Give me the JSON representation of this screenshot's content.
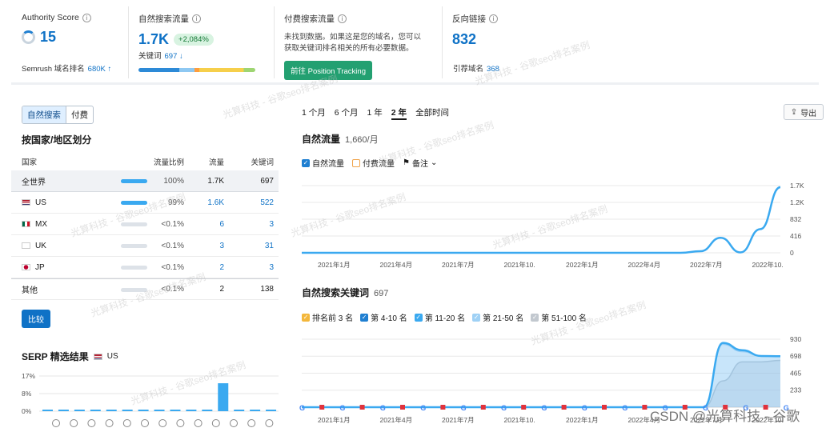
{
  "metrics": {
    "authority": {
      "label": "Authority Score",
      "value": "15",
      "sub_label": "Semrush 域名排名",
      "sub_value": "680K ↑"
    },
    "organic": {
      "label": "自然搜索流量",
      "value": "1.7K",
      "change": "+2,084%",
      "kw_label": "关键词",
      "kw_value": "697 ↓"
    },
    "paid": {
      "label": "付费搜索流量",
      "text": "未找到数据。如果这是您的域名，您可以获取关键词排名相关的所有必要数据。",
      "button": "前往 Position Tracking"
    },
    "backlinks": {
      "label": "反向链接",
      "value": "832",
      "sub_label": "引荐域名",
      "sub_value": "368"
    }
  },
  "left": {
    "toggle": [
      "自然搜索",
      "付费"
    ],
    "geo_title": "按国家/地区划分",
    "geo_columns": [
      "国家",
      "流量比例",
      "流量",
      "关键词"
    ],
    "geo_rows": [
      {
        "name": "全世界",
        "share": "100%",
        "traffic": "1.7K",
        "keywords": "697",
        "bar": 1.0
      },
      {
        "name": "US",
        "share": "99%",
        "traffic": "1.6K",
        "keywords": "522",
        "bar": 0.99
      },
      {
        "name": "MX",
        "share": "<0.1%",
        "traffic": "6",
        "keywords": "3",
        "bar": 0.0
      },
      {
        "name": "UK",
        "share": "<0.1%",
        "traffic": "3",
        "keywords": "31",
        "bar": 0.0
      },
      {
        "name": "JP",
        "share": "<0.1%",
        "traffic": "2",
        "keywords": "3",
        "bar": 0.0
      },
      {
        "name": "其他",
        "share": "<0.1%",
        "traffic": "2",
        "keywords": "138",
        "bar": 0.0
      }
    ],
    "compare_button": "比较",
    "serp_title": "SERP 精选结果",
    "serp_country": "US",
    "serp_ticks": [
      "17%",
      "8%",
      "0%"
    ],
    "serp_values": [
      0.2,
      0.2,
      0.2,
      0.2,
      0.2,
      0.3,
      0.2,
      0.2,
      0.2,
      0.2,
      0.2,
      13.5,
      0.2,
      0.2,
      0.2
    ],
    "serp_icons": [
      "graduation-icon",
      "pin-icon",
      "doc-icon",
      "image-icon",
      "link-icon",
      "list-icon",
      "star-icon",
      "play-icon",
      "video-icon",
      "crown-icon",
      "picture-icon",
      "news-icon",
      "chat-icon",
      "help-icon"
    ]
  },
  "right": {
    "periods": [
      "1 个月",
      "6 个月",
      "1 年",
      "2 年",
      "全部时间"
    ],
    "active_period": 3,
    "export": "导出",
    "traffic_title": "自然流量",
    "traffic_value": "1,660/月",
    "traffic_legend": [
      "自然流量",
      "付费流量",
      "备注"
    ],
    "kw_title": "自然搜索关键词",
    "kw_value": "697",
    "kw_legend": [
      "排名前 3 名",
      "第 4-10 名",
      "第 11-20 名",
      "第 21-50 名",
      "第 51-100 名"
    ],
    "watermark": "光算科技 - 谷歌seo排名案例",
    "csdn": "CSDN @光算科技 - 谷歌"
  },
  "chart_data": [
    {
      "type": "line",
      "title": "自然流量",
      "x": [
        "2021年1月",
        "2021年4月",
        "2021年7月",
        "2021年10.",
        "2022年1月",
        "2022年4月",
        "2022年7月",
        "2022年10."
      ],
      "y_ticks": [
        "0",
        "416",
        "832",
        "1.2K",
        "1.7K"
      ],
      "ylim": [
        0,
        1700
      ],
      "series": [
        {
          "name": "自然流量",
          "color": "#3aa9f0",
          "values": [
            0,
            0,
            0,
            0,
            0,
            0,
            0,
            0,
            0,
            0,
            0,
            0,
            0,
            0,
            0,
            0,
            0,
            0,
            0,
            0,
            40,
            380,
            10,
            600,
            1660
          ]
        }
      ]
    },
    {
      "type": "area",
      "title": "自然搜索关键词",
      "x": [
        "2021年1月",
        "2021年4月",
        "2021年7月",
        "2021年10.",
        "2022年1月",
        "2022年4月",
        "2022年7月",
        "2022年10."
      ],
      "y_ticks": [
        "233",
        "465",
        "698",
        "930"
      ],
      "ylim": [
        0,
        930
      ],
      "series": [
        {
          "name": "第 51-100 名",
          "color": "#bcc3cb",
          "values": [
            0,
            0,
            0,
            0,
            0,
            0,
            0,
            0,
            0,
            0,
            0,
            0,
            0,
            0,
            0,
            0,
            0,
            0,
            0,
            0,
            0,
            0,
            360,
            620,
            620,
            640
          ]
        },
        {
          "name": "第 21-50 名",
          "color": "#a8d4f5",
          "values": [
            0,
            0,
            0,
            0,
            0,
            0,
            0,
            0,
            0,
            0,
            0,
            0,
            0,
            0,
            0,
            0,
            0,
            0,
            0,
            0,
            0,
            0,
            860,
            760,
            700,
            697
          ]
        },
        {
          "name": "第 11-20 名",
          "color": "#3aa9f0",
          "values": [
            0,
            0,
            0,
            0,
            0,
            0,
            0,
            0,
            0,
            0,
            0,
            0,
            0,
            0,
            0,
            0,
            0,
            0,
            0,
            0,
            0,
            0,
            880,
            780,
            700,
            697
          ]
        }
      ]
    }
  ]
}
